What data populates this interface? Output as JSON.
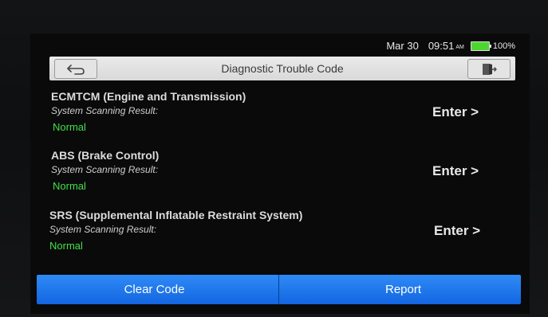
{
  "status": {
    "date": "Mar 30",
    "time": "09:51",
    "ampm": "AM",
    "battery": "100%"
  },
  "header": {
    "title": "Diagnostic Trouble Code",
    "back_icon": "back-arrow-icon",
    "exit_icon": "exit-door-icon"
  },
  "systems": [
    {
      "name": "ECMTCM (Engine and Transmission)",
      "scan_label": "System Scanning Result:",
      "status": "Normal",
      "action": "Enter >"
    },
    {
      "name": "ABS (Brake Control)",
      "scan_label": "System Scanning Result:",
      "status": "Normal",
      "action": "Enter >"
    },
    {
      "name": "SRS (Supplemental Inflatable Restraint System)",
      "scan_label": "System Scanning Result:",
      "status": "Normal",
      "action": "Enter >"
    }
  ],
  "footer": {
    "clear_label": "Clear Code",
    "report_label": "Report"
  },
  "colors": {
    "status_normal": "#40e04a",
    "button_blue": "#1f77ee",
    "title_bar": "#e0e0e0",
    "battery": "#4cd62f"
  }
}
